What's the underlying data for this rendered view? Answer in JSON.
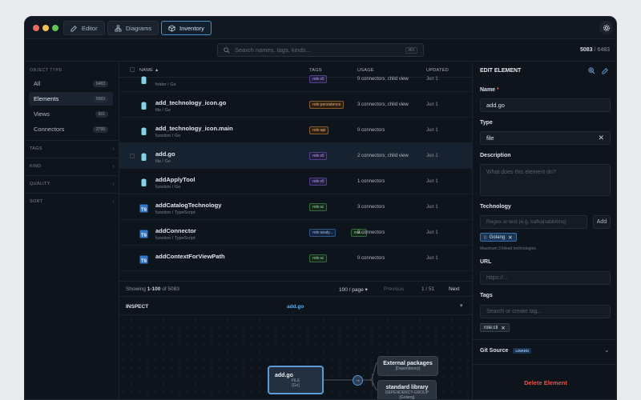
{
  "tabs": [
    {
      "label": "Editor",
      "icon": "edit-icon"
    },
    {
      "label": "Diagrams",
      "icon": "diagram-icon"
    },
    {
      "label": "Inventory",
      "icon": "cube-icon",
      "active": true
    }
  ],
  "search": {
    "placeholder": "Search names, tags, kinds...",
    "shortcut": "⌘K"
  },
  "count": {
    "shown": "5083",
    "total": "/ 6483"
  },
  "sidebar": {
    "object_type_title": "OBJECT TYPE",
    "items": [
      {
        "label": "All",
        "badge": "6483"
      },
      {
        "label": "Elements",
        "badge": "5083",
        "active": true
      },
      {
        "label": "Views",
        "badge": "601"
      },
      {
        "label": "Connectors",
        "badge": "2799"
      }
    ],
    "sections": [
      "TAGS",
      "KIND",
      "QUALITY",
      "SORT"
    ]
  },
  "table": {
    "headers": {
      "name": "NAME ▲",
      "tags": "TAGS",
      "usage": "USAGE",
      "updated": "UPDATED"
    },
    "rows": [
      {
        "name": "",
        "sub": "folder / Go",
        "tags": [
          {
            "text": "role:cli",
            "color": "purple"
          }
        ],
        "usage": "0 connectors, child view",
        "updated": "Jun 1",
        "icon": "file-icon"
      },
      {
        "name": "add_technology_icon.go",
        "sub": "file / Go",
        "tags": [
          {
            "text": "role:persistence",
            "color": "orange"
          }
        ],
        "usage": "3 connectors, child view",
        "updated": "Jun 1",
        "icon": "file-icon"
      },
      {
        "name": "add_technology_icon.main",
        "sub": "function / Go",
        "tags": [
          {
            "text": "role:api",
            "color": "orange"
          }
        ],
        "usage": "0 connectors",
        "updated": "Jun 1",
        "icon": "file-icon"
      },
      {
        "name": "add.go",
        "sub": "file / Go",
        "tags": [
          {
            "text": "role:cli",
            "color": "purple"
          }
        ],
        "usage": "2 connectors, child view",
        "updated": "Jun 1",
        "icon": "file-icon",
        "selected": true
      },
      {
        "name": "addApplyTool",
        "sub": "function / Go",
        "tags": [
          {
            "text": "role:cli",
            "color": "purple"
          }
        ],
        "usage": "1 connectors",
        "updated": "Jun 1",
        "icon": "file-icon"
      },
      {
        "name": "addCatalogTechnology",
        "sub": "function / TypeScript",
        "tags": [
          {
            "text": "role:ui",
            "color": "green"
          }
        ],
        "usage": "3 connectors",
        "updated": "Jun 1",
        "icon": "ts-icon"
      },
      {
        "name": "addConnector",
        "sub": "function / TypeScript",
        "tags": [
          {
            "text": "role:analy...",
            "color": "blue"
          },
          {
            "text": "role...",
            "color": "green"
          }
        ],
        "usage": "3 connectors",
        "updated": "Jun 1",
        "icon": "ts-icon"
      },
      {
        "name": "addContextForViewPath",
        "sub": "",
        "tags": [
          {
            "text": "role:ui",
            "color": "green"
          }
        ],
        "usage": "0 connectors",
        "updated": "Jun 1",
        "icon": "ts-icon"
      }
    ]
  },
  "pager": {
    "showing_prefix": "Showing",
    "range": "1-100",
    "of": "of 5083",
    "per_page": "100 / page",
    "prev": "Previous",
    "page": "1 / 51",
    "next": "Next"
  },
  "inspect": {
    "title": "INSPECT",
    "target": "add.go",
    "nodes": {
      "main": {
        "title": "add.go",
        "kind": "FILE",
        "tech": "[Go]"
      },
      "ext": {
        "title": "External packages",
        "kind": "[Dependency]"
      },
      "std": {
        "title": "standard library",
        "kind": "DEPENDENCY-GROUP",
        "tech": "[Golang]"
      }
    }
  },
  "panel": {
    "title": "EDIT ELEMENT",
    "name_label": "Name",
    "name_required": "*",
    "name_value": "add.go",
    "type_label": "Type",
    "type_value": "file",
    "desc_label": "Description",
    "desc_placeholder": "What does this element do?",
    "tech_label": "Technology",
    "tech_placeholder": "Regex or text (e.g. kafka|rabbitmq)",
    "tech_add": "Add",
    "tech_chip": "Golang",
    "tech_hint": "Maximum 3 linked technologies.",
    "url_label": "URL",
    "url_placeholder": "https://...",
    "tags_label": "Tags",
    "tags_placeholder": "Search or create tag...",
    "tag_chip": "role:cli",
    "git_label": "Git Source",
    "git_badge": "LINKED",
    "delete": "Delete Element"
  },
  "colors": {
    "accent": "#4a90c8",
    "danger": "#e5534b",
    "bg": "#0e141c"
  }
}
